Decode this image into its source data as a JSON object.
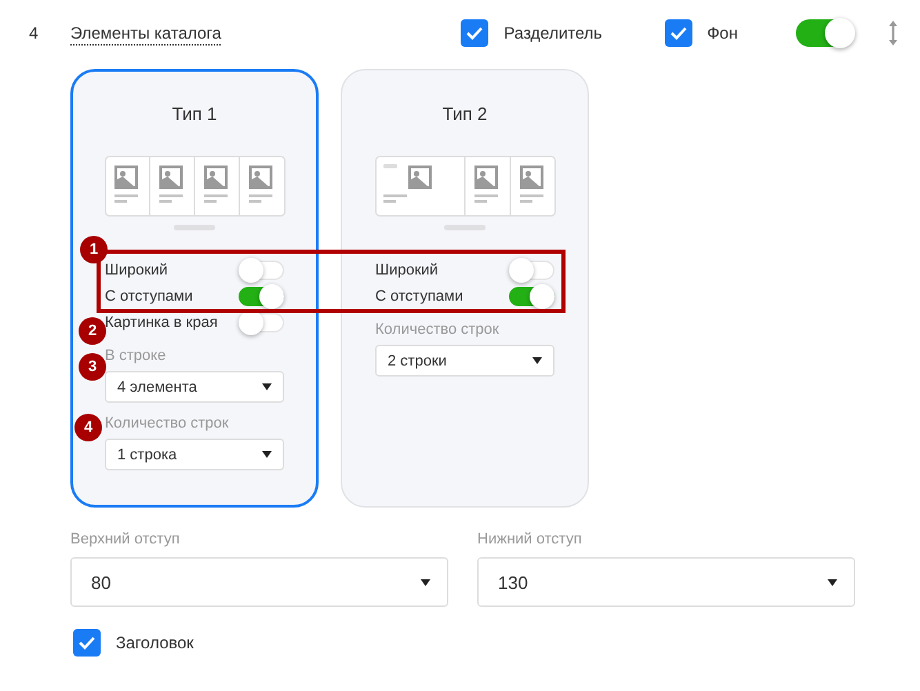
{
  "header": {
    "number": "4",
    "title": "Элементы каталога",
    "checkboxes": [
      {
        "label": "Разделитель",
        "checked": true
      },
      {
        "label": "Фон",
        "checked": true
      }
    ],
    "toggle": {
      "on": true
    }
  },
  "cards": [
    {
      "title": "Тип 1",
      "selected": true,
      "preview": {
        "kind": "equal"
      },
      "options": [
        {
          "kind": "toggle",
          "label": "Широкий",
          "on": false,
          "badge": "1"
        },
        {
          "kind": "toggle",
          "label": "С отступами",
          "on": true
        },
        {
          "kind": "toggle",
          "label": "Картинка в края",
          "on": false,
          "badge": "2"
        },
        {
          "kind": "select",
          "label": "В строке",
          "value": "4 элемента",
          "badge": "3"
        },
        {
          "kind": "select",
          "label": "Количество строк",
          "value": "1 строка",
          "badge": "4"
        }
      ]
    },
    {
      "title": "Тип 2",
      "selected": false,
      "preview": {
        "kind": "wide"
      },
      "options": [
        {
          "kind": "toggle",
          "label": "Широкий",
          "on": false
        },
        {
          "kind": "toggle",
          "label": "С отступами",
          "on": true
        },
        {
          "kind": "select",
          "label": "Количество строк",
          "value": "2 строки"
        }
      ]
    }
  ],
  "spacing": [
    {
      "label": "Верхний отступ",
      "value": "80"
    },
    {
      "label": "Нижний отступ",
      "value": "130"
    }
  ],
  "title_checkbox": {
    "label": "Заголовок",
    "checked": true
  }
}
